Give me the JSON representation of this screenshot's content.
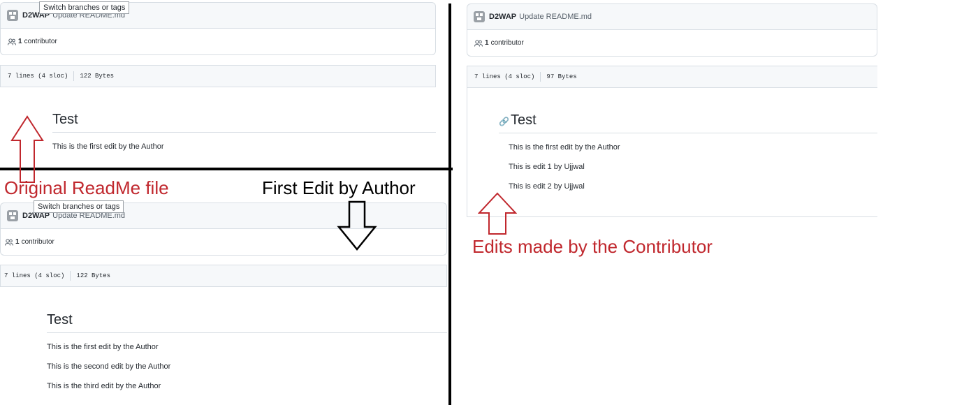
{
  "tooltip": "Switch branches or tags",
  "original_panel": {
    "author": "D2WAP",
    "commit_message": "Update README.md",
    "contributor_count": "1",
    "contributor_label": "contributor",
    "lines": "7 lines (4 sloc)",
    "size": "122 Bytes",
    "heading": "Test",
    "paragraphs": [
      "This is the first edit by the Author"
    ]
  },
  "author_edit_panel": {
    "author": "D2WAP",
    "commit_message": "Update README.md",
    "contributor_count": "1",
    "contributor_label": "contributor",
    "lines": "7 lines (4 sloc)",
    "size": "122 Bytes",
    "heading": "Test",
    "paragraphs": [
      "This is the first edit by the Author",
      "This is the second edit by the Author",
      "This is the third edit by the Author"
    ]
  },
  "contributor_panel": {
    "author": "D2WAP",
    "commit_message": "Update README.md",
    "contributor_count": "1",
    "contributor_label": "contributor",
    "lines": "7 lines (4 sloc)",
    "size": "97 Bytes",
    "heading": "Test",
    "paragraphs": [
      "This is the first edit by the Author",
      "This is edit 1 by Ujjwal",
      "This is edit 2 by Ujjwal"
    ]
  },
  "annotations": {
    "original": "Original ReadMe file",
    "first_edit": "First Edit by Author",
    "contributor_edits": "Edits made by the Contributor"
  },
  "colors": {
    "annotation_red": "#c0272d",
    "annotation_black": "#000000",
    "header_bg": "#f6f8fa",
    "border": "#d8dee4"
  },
  "icons": [
    "avatar-icon",
    "people-icon",
    "link-icon",
    "up-arrow-icon",
    "down-arrow-icon"
  ]
}
